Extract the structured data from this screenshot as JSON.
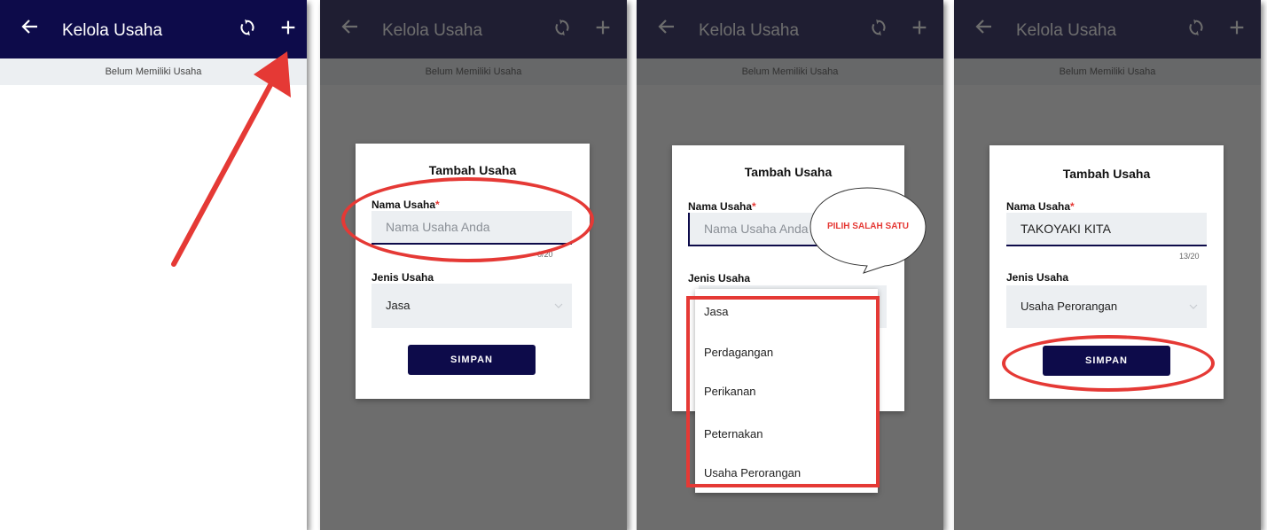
{
  "app": {
    "title": "Kelola Usaha",
    "subtitle": "Belum Memiliki Usaha"
  },
  "colors": {
    "appbar": "#0d0b4a",
    "accent_red": "#e53935",
    "overlay": "#3a3a3a"
  },
  "icons": [
    "back-arrow-icon",
    "refresh-icon",
    "plus-icon",
    "chevron-down-icon"
  ],
  "dialog": {
    "title": "Tambah Usaha",
    "name_label": "Nama Usaha",
    "required_mark": "*",
    "name_placeholder": "Nama Usaha Anda",
    "type_label": "Jenis Usaha",
    "save_label": "SIMPAN"
  },
  "panel2": {
    "counter": "0/20",
    "type_value": "Jasa"
  },
  "panel3": {
    "callout": "PILIH SALAH SATU",
    "options": [
      "Jasa",
      "Perdagangan",
      "Perikanan",
      "Peternakan",
      "Usaha Perorangan"
    ]
  },
  "panel4": {
    "name_value": "TAKOYAKI KITA",
    "counter": "13/20",
    "type_value": "Usaha Perorangan"
  }
}
